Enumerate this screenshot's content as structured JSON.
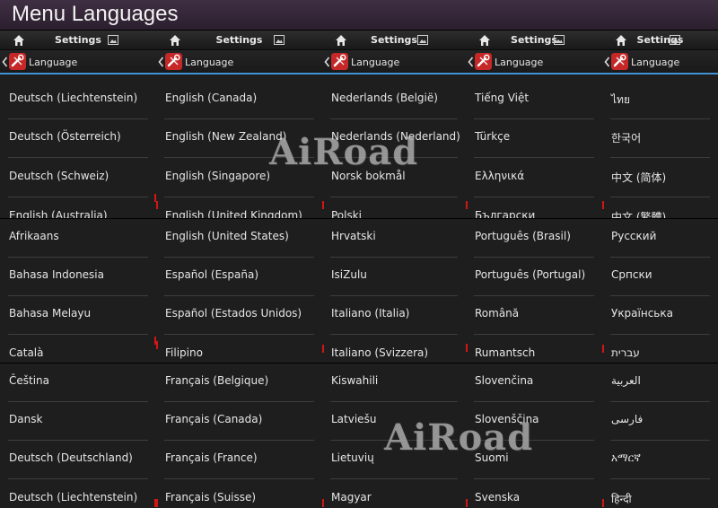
{
  "title": "Menu Languages",
  "settings_title": "Settings",
  "language_title": "Language",
  "watermark": "AiRoad",
  "colors": {
    "accent": "#3f91d3",
    "scroll_marker": "#d21515",
    "app_icon": "#c62828"
  },
  "panels": [
    {
      "segments": [
        [
          "Deutsch (Liechtenstein)",
          "Deutsch (Österreich)",
          "Deutsch (Schweiz)",
          "English (Australia)"
        ],
        [
          "Afrikaans",
          "Bahasa Indonesia",
          "Bahasa Melayu",
          "Català"
        ],
        [
          "Čeština",
          "Dansk",
          "Deutsch (Deutschland)",
          "Deutsch (Liechtenstein)"
        ]
      ]
    },
    {
      "segments": [
        [
          "English (Canada)",
          "English (New Zealand)",
          "English (Singapore)",
          "English (United Kingdom)"
        ],
        [
          "English (United States)",
          "Español (España)",
          "Español (Estados Unidos)",
          "Filipino"
        ],
        [
          "Français (Belgique)",
          "Français (Canada)",
          "Français (France)",
          "Français (Suisse)"
        ]
      ]
    },
    {
      "segments": [
        [
          "Nederlands (België)",
          "Nederlands (Nederland)",
          "Norsk bokmål",
          "Polski"
        ],
        [
          "Hrvatski",
          "IsiZulu",
          "Italiano (Italia)",
          "Italiano (Svizzera)"
        ],
        [
          "Kiswahili",
          "Latviešu",
          "Lietuvių",
          "Magyar"
        ]
      ]
    },
    {
      "segments": [
        [
          "Tiếng Việt",
          "Türkçe",
          "Ελληνικά",
          "Български"
        ],
        [
          "Português (Brasil)",
          "Português (Portugal)",
          "Română",
          "Rumantsch"
        ],
        [
          "Slovenčina",
          "Slovenščina",
          "Suomi",
          "Svenska"
        ]
      ]
    },
    {
      "segments": [
        [
          "ไทย",
          "한국어",
          "中文 (简体)",
          "中文 (繁體)"
        ],
        [
          "Русский",
          "Српски",
          "Українська",
          "עברית"
        ],
        [
          "العربية",
          "فارسی",
          "አማርኛ",
          "हिन्दी"
        ]
      ]
    }
  ]
}
